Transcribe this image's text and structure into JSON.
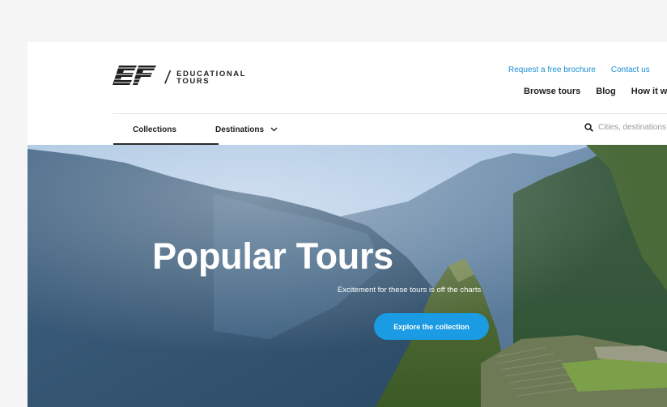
{
  "brand": {
    "logo_mark": "EF",
    "logo_line1": "EDUCATIONAL",
    "logo_line2": "TOURS"
  },
  "header": {
    "util_links": [
      {
        "label": "Request a free brochure"
      },
      {
        "label": "Contact us"
      }
    ],
    "main_links": [
      {
        "label": "Browse tours"
      },
      {
        "label": "Blog"
      },
      {
        "label": "How it works"
      }
    ]
  },
  "subnav": {
    "tabs": [
      {
        "label": "Collections",
        "active": true
      },
      {
        "label": "Destinations",
        "has_dropdown": true
      }
    ],
    "search": {
      "placeholder": "Cities, destinations",
      "icon": "search-icon"
    }
  },
  "hero": {
    "title": "Popular Tours",
    "subtitle": "Excitement for these tours is off the charts",
    "cta_label": "Explore the collection"
  },
  "colors": {
    "accent": "#1a9be3",
    "link": "#1a8fd6",
    "text": "#1e1e1e"
  }
}
